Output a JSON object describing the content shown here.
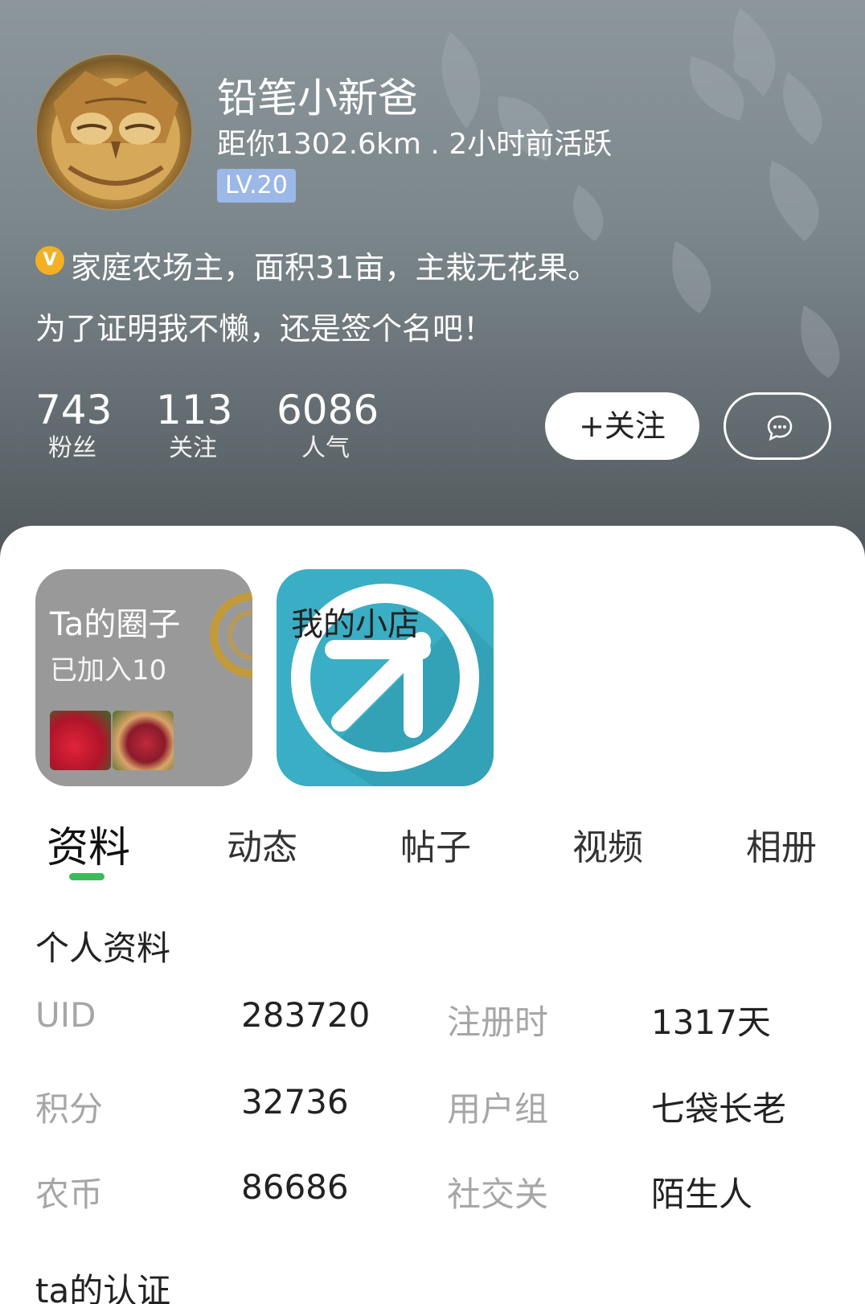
{
  "profile": {
    "name": "铅笔小新爸",
    "meta": "距你1302.6km . 2小时前活跃",
    "level": "LV.20",
    "verified_badge": "V",
    "certification": "家庭农场主，面积31亩，主栽无花果。",
    "signature": "为了证明我不懒，还是签个名吧！"
  },
  "stats": [
    {
      "value": "743",
      "label": "粉丝"
    },
    {
      "value": "113",
      "label": "关注"
    },
    {
      "value": "6086",
      "label": "人气"
    }
  ],
  "actions": {
    "follow_label": "+关注",
    "chat_icon": "chat-bubble-icon"
  },
  "tiles": {
    "circle": {
      "title": "Ta的圈子",
      "subtitle": "已加入10"
    },
    "shop": {
      "title": "我的小店"
    }
  },
  "tabs": [
    "资料",
    "动态",
    "帖子",
    "视频",
    "相册"
  ],
  "active_tab": "资料",
  "personal_info": {
    "title": "个人资料",
    "rows": [
      {
        "k1": "UID",
        "v1": "283720",
        "k2": "注册时",
        "v2": "1317天"
      },
      {
        "k1": "积分",
        "v1": "32736",
        "k2": "用户组",
        "v2": "七袋长老"
      },
      {
        "k1": "农币",
        "v1": "86686",
        "k2": "社交关",
        "v2": "陌生人"
      }
    ]
  },
  "certification_section": {
    "title": "ta的认证"
  },
  "colors": {
    "accent": "#3dbb5b",
    "level_badge": "#9bb8e6",
    "verified": "#f3b024",
    "shop_tile": "#3aaec4",
    "circle_tile": "#999999"
  }
}
